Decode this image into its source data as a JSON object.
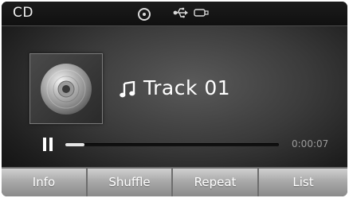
{
  "status_bar": {
    "source": "CD",
    "icons": [
      "disc-icon",
      "usb-icon",
      "usb-plug-icon"
    ]
  },
  "now_playing": {
    "track_title": "Track 01",
    "elapsed_time": "0:00:07",
    "progress_fraction": 0.09,
    "state": "playing",
    "album_art_icon": "cd-disc-icon",
    "note_icon": "music-note-icon"
  },
  "buttons": {
    "info": "Info",
    "shuffle": "Shuffle",
    "repeat": "Repeat",
    "list": "List"
  },
  "colors": {
    "background": "#3b3b3b",
    "button_face": "#a9a9a9",
    "progress_fill": "#e6e6e6",
    "time_text": "#9a9a9a"
  }
}
